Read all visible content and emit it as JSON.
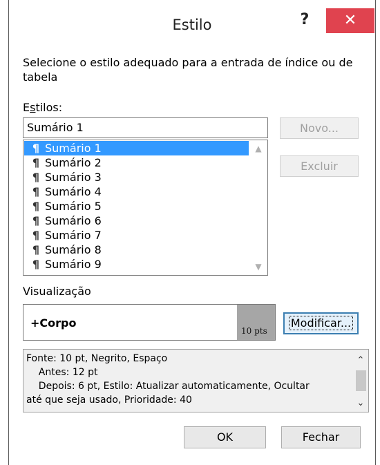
{
  "dialog": {
    "title": "Estilo",
    "help": "?",
    "close": "✕",
    "instruction": "Selecione o estilo adequado para a entrada de índice ou de tabela"
  },
  "styles": {
    "label": "Estilos:",
    "current_value": "Sumário 1",
    "items": [
      "Sumário 1",
      "Sumário 2",
      "Sumário 3",
      "Sumário 4",
      "Sumário 5",
      "Sumário 6",
      "Sumário 7",
      "Sumário 8",
      "Sumário 9"
    ],
    "selected": "Sumário 1",
    "item_glyph": "¶"
  },
  "buttons": {
    "novo": "Novo...",
    "excluir": "Excluir",
    "modificar": "Modificar...",
    "ok": "OK",
    "fechar": "Fechar"
  },
  "preview": {
    "label": "Visualização",
    "sample_text": "+Corpo",
    "size_label": "10 pts"
  },
  "description": {
    "lines": [
      "Fonte: 10 pt, Negrito, Espaço",
      "    Antes: 12 pt",
      "    Depois: 6 pt, Estilo: Atualizar automaticamente, Ocultar",
      "até que seja usado, Prioridade: 40"
    ]
  },
  "colors": {
    "close_button": "#e0434f",
    "selection": "#3399ff",
    "preview_gray": "#a6a6a6"
  }
}
